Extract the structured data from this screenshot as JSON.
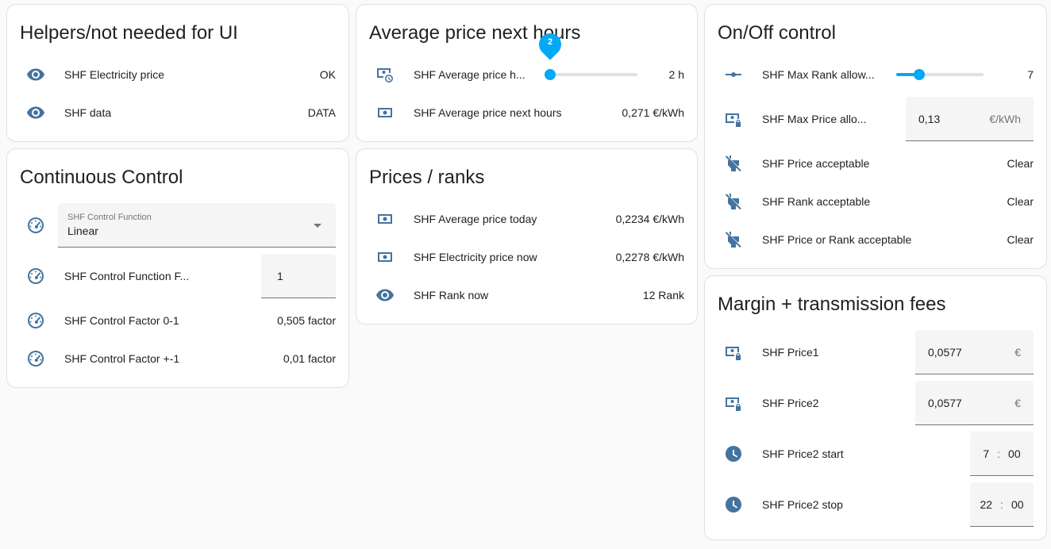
{
  "cards": {
    "helpers": {
      "title": "Helpers/not needed for UI",
      "rows": [
        {
          "icon": "eye-icon",
          "label": "SHF Electricity price",
          "value": "OK"
        },
        {
          "icon": "eye-icon",
          "label": "SHF data",
          "value": "DATA"
        }
      ]
    },
    "average": {
      "title": "Average price next hours",
      "slider": {
        "icon": "cash-clock-icon",
        "label": "SHF Average price h...",
        "pin": "2",
        "value": "2 h",
        "level_fraction": 0.0
      },
      "rows": [
        {
          "icon": "cash-icon",
          "label": "SHF Average price next hours",
          "value": "0,271 €/kWh"
        }
      ]
    },
    "onoff": {
      "title": "On/Off control",
      "slider": {
        "icon": "ray-vertex-icon",
        "label": "SHF Max Rank allow...",
        "value": "7",
        "level_fraction": 0.26
      },
      "field": {
        "icon": "cash-lock-icon",
        "label": "SHF Max Price allo...",
        "value": "0,13",
        "suffix": "€/kWh"
      },
      "rows": [
        {
          "icon": "power-plug-off-icon",
          "label": "SHF Price acceptable",
          "value": "Clear"
        },
        {
          "icon": "power-plug-off-icon",
          "label": "SHF Rank acceptable",
          "value": "Clear"
        },
        {
          "icon": "power-plug-off-icon",
          "label": "SHF Price or Rank acceptable",
          "value": "Clear"
        }
      ]
    },
    "continuous": {
      "title": "Continuous Control",
      "select": {
        "icon": "gauge-icon",
        "label": "SHF Control Function",
        "value": "Linear"
      },
      "field": {
        "icon": "gauge-icon",
        "label": "SHF Control Function F...",
        "value": "1"
      },
      "rows": [
        {
          "icon": "gauge-icon",
          "label": "SHF Control Factor 0-1",
          "value": "0,505 factor"
        },
        {
          "icon": "gauge-icon",
          "label": "SHF Control Factor +-1",
          "value": "0,01 factor"
        }
      ]
    },
    "prices": {
      "title": "Prices / ranks",
      "rows": [
        {
          "icon": "cash-icon",
          "label": "SHF Average price today",
          "value": "0,2234 €/kWh"
        },
        {
          "icon": "cash-icon",
          "label": "SHF Electricity price now",
          "value": "0,2278 €/kWh"
        },
        {
          "icon": "eye-icon",
          "label": "SHF Rank now",
          "value": "12 Rank"
        }
      ]
    },
    "margin": {
      "title": "Margin + transmission fees",
      "fields": [
        {
          "icon": "cash-lock-icon",
          "label": "SHF Price1",
          "value": "0,0577",
          "suffix": "€"
        },
        {
          "icon": "cash-lock-icon",
          "label": "SHF Price2",
          "value": "0,0577",
          "suffix": "€"
        }
      ],
      "times": [
        {
          "icon": "clock-icon",
          "label": "SHF Price2 start",
          "hour": "7",
          "sep": ":",
          "minute": "00"
        },
        {
          "icon": "clock-icon",
          "label": "SHF Price2 stop",
          "hour": "22",
          "sep": ":",
          "minute": "00"
        }
      ]
    }
  },
  "colors": {
    "icon": "#44739e",
    "accent": "#03a9f4",
    "card_bg": "#ffffff",
    "page_bg": "#fafafa"
  }
}
